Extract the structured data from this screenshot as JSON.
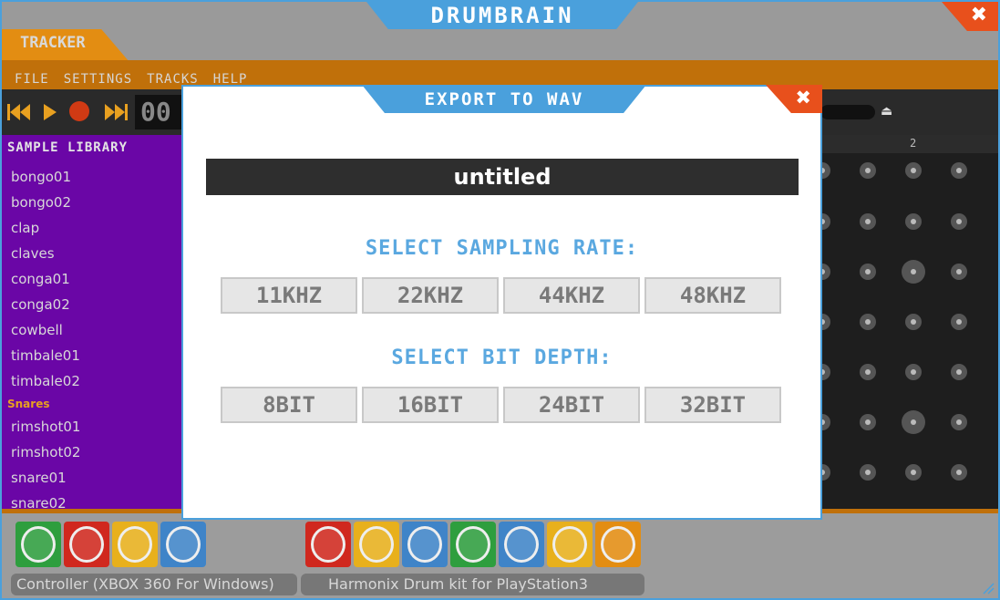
{
  "window": {
    "title": "DRUMBRAIN",
    "close_glyph": "✖"
  },
  "tracker_tab": "TRACKER",
  "menu": [
    "FILE",
    "SETTINGS",
    "TRACKS",
    "HELP"
  ],
  "transport": {
    "counter": "00",
    "beat_marker": "2",
    "eject_glyph": "⏏"
  },
  "sample_library": {
    "title": "SAMPLE LIBRARY",
    "items_before": [
      "bongo01",
      "bongo02",
      "clap",
      "claves",
      "conga01",
      "conga02",
      "cowbell",
      "timbale01",
      "timbale02"
    ],
    "category": "Snares",
    "items_after": [
      "rimshot01",
      "rimshot02",
      "snare01",
      "snare02"
    ]
  },
  "devices": {
    "controller_label": "Controller (XBOX 360 For Windows)",
    "drumkit_label": "Harmonix Drum kit for PlayStation3",
    "controller_pad_colors": [
      "#2e9e3e",
      "#d0281e",
      "#e8b01c",
      "#3f84c8"
    ],
    "drumkit_pad_colors": [
      "#d0281e",
      "#e8b01c",
      "#3f84c8",
      "#2e9e3e",
      "#3f84c8",
      "#e8b01c",
      "#e38d12"
    ]
  },
  "modal": {
    "title": "EXPORT TO WAV",
    "close_glyph": "✖",
    "filename": "untitled",
    "sampling_label": "SELECT SAMPLING RATE:",
    "sampling_options": [
      "11KHZ",
      "22KHZ",
      "44KHZ",
      "48KHZ"
    ],
    "bitdepth_label": "SELECT BIT DEPTH:",
    "bitdepth_options": [
      "8BIT",
      "16BIT",
      "24BIT",
      "32BIT"
    ]
  },
  "colors": {
    "accent_blue": "#4aa0dc",
    "accent_orange": "#e38d12",
    "close_red": "#e8501c",
    "library_purple": "#6a06a6"
  }
}
